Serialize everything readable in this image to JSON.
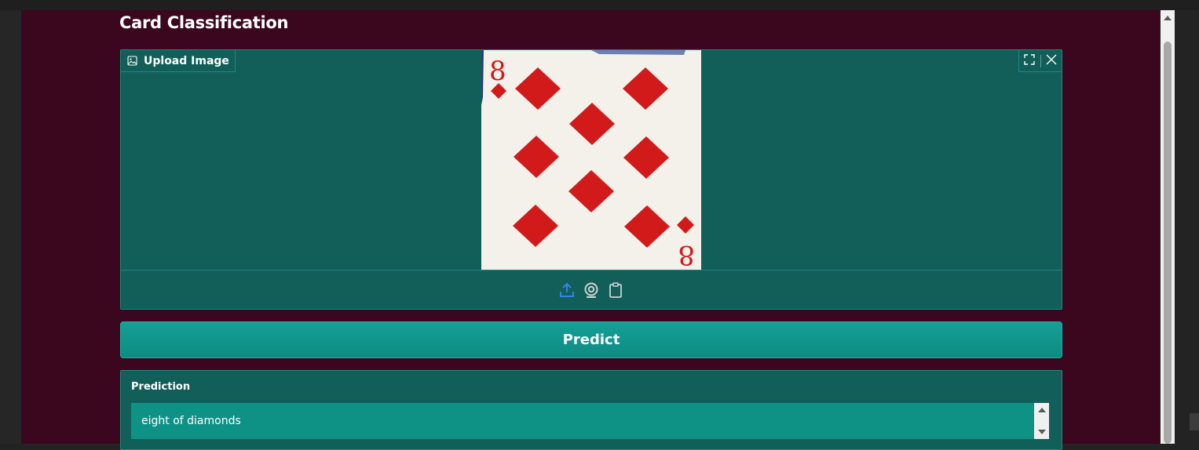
{
  "app": {
    "title": "Card Classification"
  },
  "image_input": {
    "label": "Upload Image",
    "image_icon": "image-icon",
    "tools": [
      "fullscreen-icon",
      "close-icon"
    ],
    "uploaded_image": {
      "card_rank_label": "8",
      "card_suit": "diamonds"
    },
    "sources": [
      {
        "name": "upload",
        "icon": "upload-icon",
        "active": true
      },
      {
        "name": "webcam",
        "icon": "webcam-icon",
        "active": false
      },
      {
        "name": "clipboard",
        "icon": "clipboard-icon",
        "active": false
      }
    ]
  },
  "predict_button": {
    "label": "Predict"
  },
  "prediction": {
    "label": "Prediction",
    "value": "eight of diamonds"
  },
  "colors": {
    "page_background": "#3a071e",
    "panel_background": "#125e59",
    "button_background": "#0e8b82",
    "output_background": "#0f9286",
    "suit_red": "#d21a1a",
    "active_icon": "#2f86ea"
  }
}
